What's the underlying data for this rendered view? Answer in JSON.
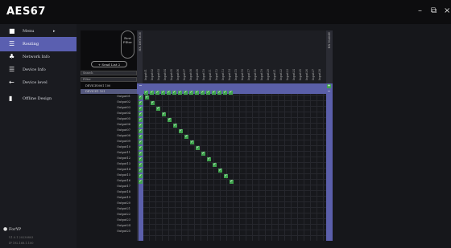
{
  "app": {
    "logo": "AES67",
    "minimize": "–",
    "maximize": "⧉",
    "close": "×"
  },
  "sidebar": {
    "items": [
      {
        "label": "Menu",
        "icon": "menu-grid-icon",
        "arrow": "▸"
      },
      {
        "label": "Routing",
        "icon": "wifi-icon"
      },
      {
        "label": "Network Info",
        "icon": "network-icon"
      },
      {
        "label": "Device Info",
        "icon": "device-info-icon"
      },
      {
        "label": "Device level",
        "icon": "arrow-left-icon"
      },
      {
        "label": "Offline Design",
        "icon": "design-icon"
      }
    ],
    "about": "ForYP",
    "version_line1": "V1.0.1 20230803",
    "version_line2": "IP 192.168.1.100"
  },
  "routing": {
    "row_filter": "Row Filter",
    "send_list": "+ Send List 2",
    "search_placeholder": "Search",
    "filter_placeholder": "Filter",
    "devices": [
      "DEVICE0001 100",
      "DEVICE1 101"
    ],
    "tx_device_name": "RX DEVICE",
    "rx_device_name": "RX NAME",
    "header_channels": [
      "Input01",
      "Input02",
      "Input03",
      "Input04",
      "Input05",
      "Input06",
      "Input07",
      "Input08",
      "Input09",
      "Input10",
      "Input11",
      "Input12",
      "Input13",
      "Input14",
      "Input15",
      "Input16",
      "Input17",
      "Input18",
      "Input19",
      "Input20",
      "Input21",
      "Input22",
      "Input23",
      "Input24",
      "Input25",
      "Input26",
      "Input27",
      "Input28"
    ],
    "output_labels": [
      "Output01",
      "Output02",
      "Output03",
      "Output04",
      "Output05",
      "Output06",
      "Output07",
      "Output08",
      "Output09",
      "Output10",
      "Output11",
      "Output12",
      "Output13",
      "Output14",
      "Output15",
      "Output16",
      "Output17",
      "Output18",
      "Output19",
      "Output20",
      "Output21",
      "Output22",
      "Output23",
      "Output24",
      "Output25"
    ],
    "checked_count": 16,
    "collapse_symbol": "−",
    "expand_symbol": "+",
    "check_symbol": "✓"
  }
}
